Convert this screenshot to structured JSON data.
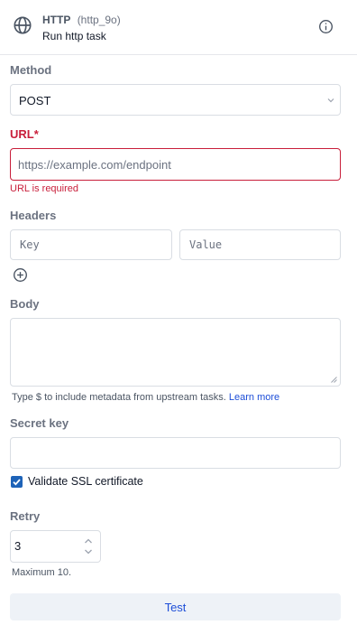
{
  "header": {
    "name": "HTTP",
    "id": "(http_9o)",
    "subtitle": "Run http task",
    "icon": "globe-icon",
    "info_icon": "info-icon"
  },
  "method": {
    "label": "Method",
    "value": "POST",
    "icon": "chevron-down-icon"
  },
  "url": {
    "label": "URL*",
    "placeholder": "https://example.com/endpoint",
    "value": "",
    "error": "URL is required"
  },
  "headers": {
    "label": "Headers",
    "key_placeholder": "Key",
    "value_placeholder": "Value",
    "add_icon": "plus-circle-icon"
  },
  "body": {
    "label": "Body",
    "value": "",
    "hint_text": "Type $ to include metadata from upstream tasks.",
    "hint_link": "Learn more"
  },
  "secret_key": {
    "label": "Secret key",
    "value": ""
  },
  "ssl": {
    "label": "Validate SSL certificate",
    "checked": true
  },
  "retry": {
    "label": "Retry",
    "value": "3",
    "note": "Maximum 10."
  },
  "test_button": {
    "label": "Test"
  },
  "colors": {
    "error": "#c81e3a",
    "accent": "#1e63b8",
    "link": "#1d4ed8"
  }
}
